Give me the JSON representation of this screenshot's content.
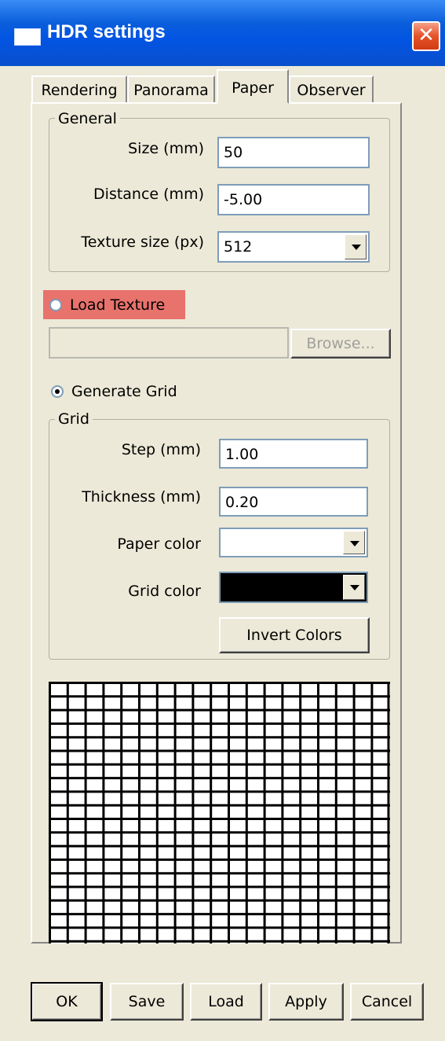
{
  "window": {
    "title": "HDR settings"
  },
  "tabs": [
    {
      "label": "Rendering",
      "active": false
    },
    {
      "label": "Panorama",
      "active": false
    },
    {
      "label": "Paper",
      "active": true
    },
    {
      "label": "Observer",
      "active": false
    }
  ],
  "general": {
    "legend": "General",
    "size_label": "Size (mm)",
    "size_value": "50",
    "distance_label": "Distance (mm)",
    "distance_value": "-5.00",
    "texture_label": "Texture size (px)",
    "texture_value": "512"
  },
  "load_texture": {
    "label": "Load Texture",
    "selected": false,
    "path_value": "",
    "browse_label": "Browse..."
  },
  "generate_grid": {
    "label": "Generate Grid",
    "selected": true
  },
  "grid": {
    "legend": "Grid",
    "step_label": "Step (mm)",
    "step_value": "1.00",
    "thickness_label": "Thickness (mm)",
    "thickness_value": "0.20",
    "paper_color_label": "Paper color",
    "paper_color": "#FFFFFF",
    "grid_color_label": "Grid color",
    "grid_color": "#000000",
    "invert_label": "Invert Colors"
  },
  "preview": {
    "cols": 19,
    "rows": 19,
    "line_color": "#000000",
    "bg_color": "#FFFFFF"
  },
  "buttons": {
    "ok": "OK",
    "save": "Save",
    "load": "Load",
    "apply": "Apply",
    "cancel": "Cancel"
  },
  "colors": {
    "titlebar": "#0A5EDB",
    "highlight": "#E8726C",
    "window_bg": "#ECE9D8"
  }
}
